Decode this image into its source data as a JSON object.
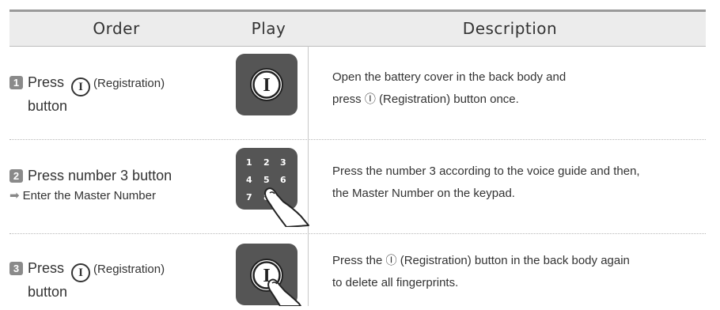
{
  "header": {
    "order": "Order",
    "play": "Play",
    "description": "Description"
  },
  "registration_glyph": "I",
  "rows": [
    {
      "step": "1",
      "order_line1_pre": "Press",
      "order_line1_post": "(Registration)",
      "order_line2": "button",
      "desc_line1": "Open the battery cover in the back body and",
      "desc_line2_pre": "press",
      "desc_line2_icon": "Ⓘ",
      "desc_line2_post": "(Registration) button once.",
      "icon": "registration-button-icon"
    },
    {
      "step": "2",
      "order_line1": "Press number 3 button",
      "order_line2": "Enter the Master Number",
      "arrow": "➡",
      "desc_line1": "Press the number 3 according to the voice guide and then,",
      "desc_line2": "the Master Number on the keypad.",
      "keypad": [
        "1",
        "2",
        "3",
        "4",
        "5",
        "6",
        "7",
        "8"
      ],
      "icon": "keypad-press-icon"
    },
    {
      "step": "3",
      "order_line1_pre": "Press",
      "order_line1_post": "(Registration)",
      "order_line2": "button",
      "desc_line1_pre": "Press the",
      "desc_line1_icon": "Ⓘ",
      "desc_line1_post": "(Registration) button in the back body again",
      "desc_line2": "to delete all fingerprints.",
      "icon": "registration-press-icon"
    }
  ]
}
